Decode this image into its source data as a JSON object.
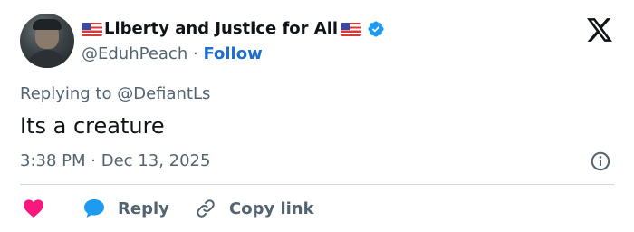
{
  "author": {
    "display_name": "Liberty and Justice for All",
    "handle": "@EduhPeach",
    "separator": "·",
    "follow_label": "Follow",
    "verified": true,
    "flag_icon": "us-flag-icon"
  },
  "brand": {
    "logo": "x-logo-icon"
  },
  "tweet": {
    "reply_prefix": "Replying to",
    "reply_to": "@DefiantLs",
    "text": "Its a creature",
    "time": "3:38 PM",
    "dot": "·",
    "date": "Dec 13, 2025"
  },
  "actions": {
    "like_icon": "heart-icon",
    "reply_label": "Reply",
    "copy_link_label": "Copy link"
  },
  "colors": {
    "accent": "#1d6fd0",
    "verified": "#1d9bf0",
    "like": "#f91880",
    "text": "#0f1419",
    "muted": "#536471",
    "divider": "#cfd9de"
  }
}
